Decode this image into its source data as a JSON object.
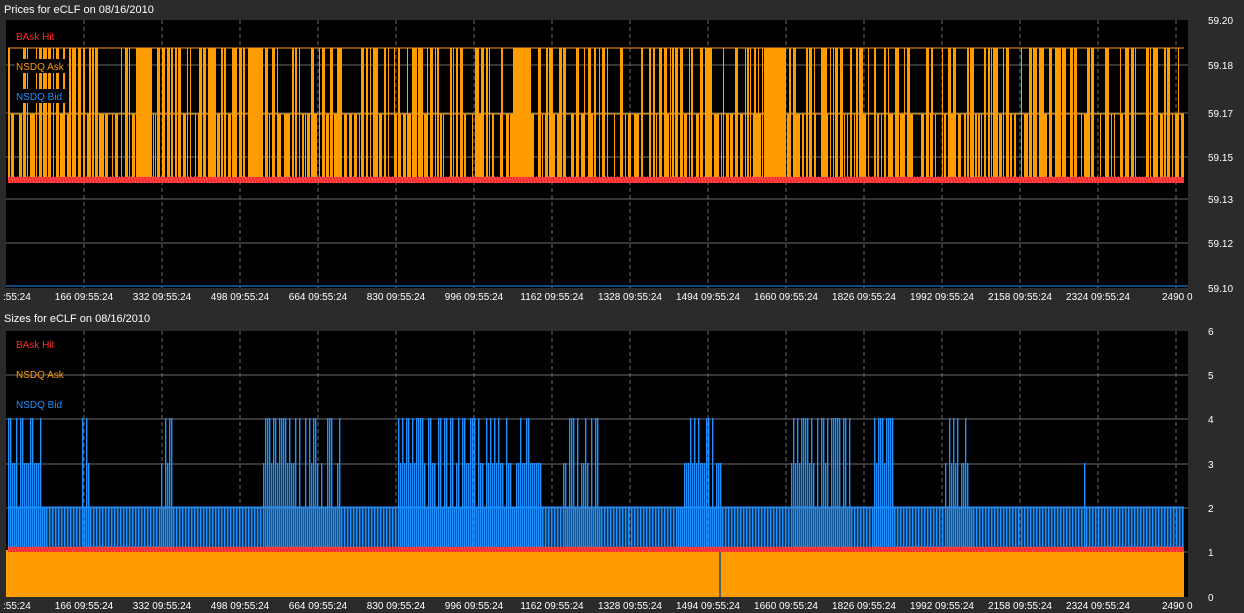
{
  "colors": {
    "background": "#2b2b2b",
    "plot_background": "#000000",
    "grid": "#6a6a6a",
    "bask_hit": "#ff2a2a",
    "nsdq_ask": "#ff9d00",
    "nsdq_bid": "#1e90ff"
  },
  "chart_data": [
    {
      "type": "line",
      "title": "Prices for  eCLF  on  08/16/2010",
      "legend": [
        "BAsk Hit",
        "NSDQ Ask",
        "NSDQ Bid"
      ],
      "legend_position": "top-left",
      "x_tick_labels": [
        ":55:24",
        "166 09:55:24",
        "332 09:55:24",
        "498 09:55:24",
        "664 09:55:24",
        "830 09:55:24",
        "996 09:55:24",
        "1162 09:55:24",
        "1328 09:55:24",
        "1494 09:55:24",
        "1660 09:55:24",
        "1826 09:55:24",
        "1992 09:55:24",
        "2158 09:55:24",
        "2324 09:55:24",
        "2490 0"
      ],
      "y_tick_labels": [
        "59.20",
        "59.18",
        "59.17",
        "59.15",
        "59.13",
        "59.12",
        "59.10"
      ],
      "xlim": [
        0,
        2490
      ],
      "ylim": [
        59.1,
        59.2
      ],
      "grid": true,
      "series": [
        {
          "name": "NSDQ Ask",
          "values_description_range": [
            59.145,
            59.19
          ],
          "levels": [
            59.145,
            59.169,
            59.19
          ]
        },
        {
          "name": "BAsk Hit",
          "level": 59.145
        },
        {
          "name": "NSDQ Bid",
          "level": 59.1
        }
      ]
    },
    {
      "type": "bar",
      "title": "Sizes for  eCLF  on  08/16/2010",
      "legend": [
        "BAsk Hit",
        "NSDQ Ask",
        "NSDQ Bid"
      ],
      "legend_position": "top-left",
      "x_tick_labels": [
        ":55:24",
        "166 09:55:24",
        "332 09:55:24",
        "498 09:55:24",
        "664 09:55:24",
        "830 09:55:24",
        "996 09:55:24",
        "1162 09:55:24",
        "1328 09:55:24",
        "1494 09:55:24",
        "1660 09:55:24",
        "1826 09:55:24",
        "1992 09:55:24",
        "2158 09:55:24",
        "2324 09:55:24",
        "2490 0"
      ],
      "y_tick_labels": [
        "6",
        "5",
        "4",
        "3",
        "2",
        "1",
        "0"
      ],
      "xlim": [
        0,
        2490
      ],
      "ylim": [
        0,
        6
      ],
      "grid": true,
      "series": [
        {
          "name": "NSDQ Ask",
          "level": 1
        },
        {
          "name": "BAsk Hit",
          "level": 1
        },
        {
          "name": "NSDQ Bid",
          "levels": [
            2,
            3,
            4
          ]
        }
      ]
    }
  ]
}
